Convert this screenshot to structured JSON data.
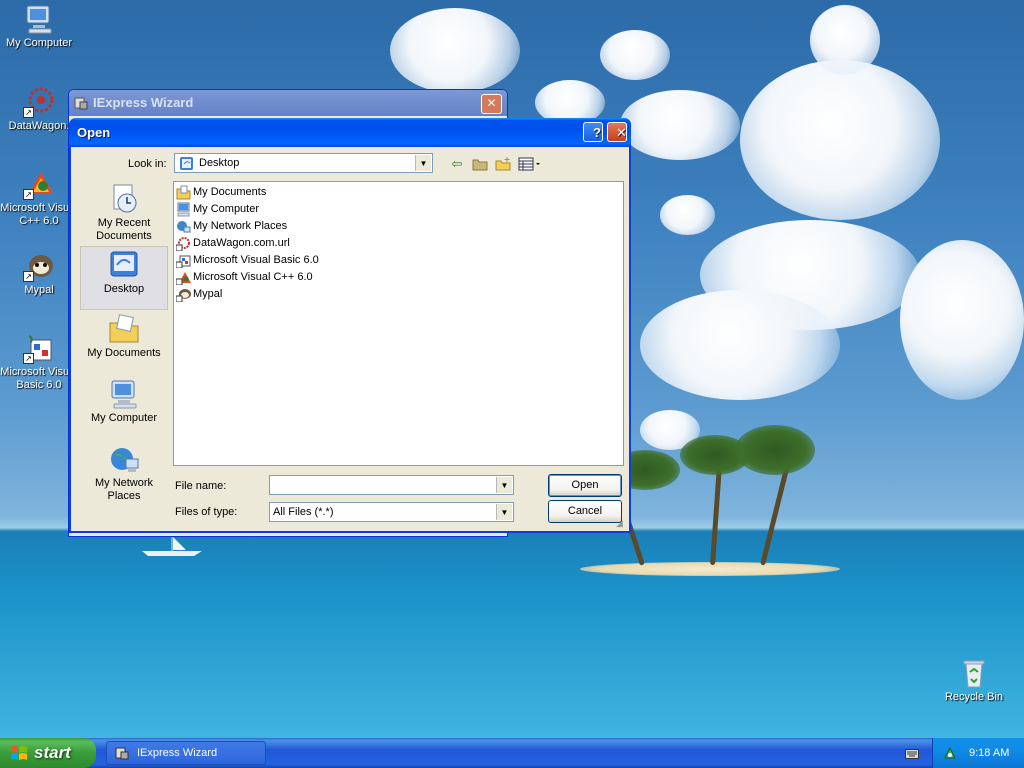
{
  "desktop": {
    "icons": [
      {
        "label": "My Computer",
        "icon": "my-computer-icon"
      },
      {
        "label": "DataWagon.",
        "icon": "datawagon-icon"
      },
      {
        "label": "Microsoft Visual C++ 6.0",
        "icon": "visual-cpp-icon"
      },
      {
        "label": "Mypal",
        "icon": "mypal-icon"
      },
      {
        "label": "Microsoft Visual Basic 6.0",
        "icon": "visual-basic-icon"
      },
      {
        "label": "Recycle Bin",
        "icon": "recycle-bin-icon"
      }
    ]
  },
  "background_window": {
    "title": "IExpress Wizard",
    "close": "✕"
  },
  "dialog": {
    "title": "Open",
    "help": "?",
    "close": "✕",
    "look_in_label": "Look in:",
    "look_in_value": "Desktop",
    "places": [
      {
        "label": "My Recent Documents",
        "icon": "recent-documents-icon"
      },
      {
        "label": "Desktop",
        "icon": "desktop-icon",
        "selected": true
      },
      {
        "label": "My Documents",
        "icon": "my-documents-icon"
      },
      {
        "label": "My Computer",
        "icon": "my-computer-icon"
      },
      {
        "label": "My Network Places",
        "icon": "network-places-icon"
      }
    ],
    "files": [
      {
        "name": "My Documents",
        "icon": "folder-icon"
      },
      {
        "name": "My Computer",
        "icon": "computer-icon"
      },
      {
        "name": "My Network Places",
        "icon": "network-icon"
      },
      {
        "name": "DataWagon.com.url",
        "icon": "url-icon"
      },
      {
        "name": "Microsoft Visual Basic 6.0",
        "icon": "shortcut-icon"
      },
      {
        "name": "Microsoft Visual C++ 6.0",
        "icon": "shortcut-icon"
      },
      {
        "name": "Mypal",
        "icon": "shortcut-icon"
      }
    ],
    "file_name_label": "File name:",
    "file_name_value": "",
    "files_of_type_label": "Files of type:",
    "files_of_type_value": "All Files (*.*)",
    "open_button": "Open",
    "cancel_button": "Cancel"
  },
  "taskbar": {
    "start_label": "start",
    "task_label": "IExpress Wizard",
    "clock": "9:18 AM"
  }
}
